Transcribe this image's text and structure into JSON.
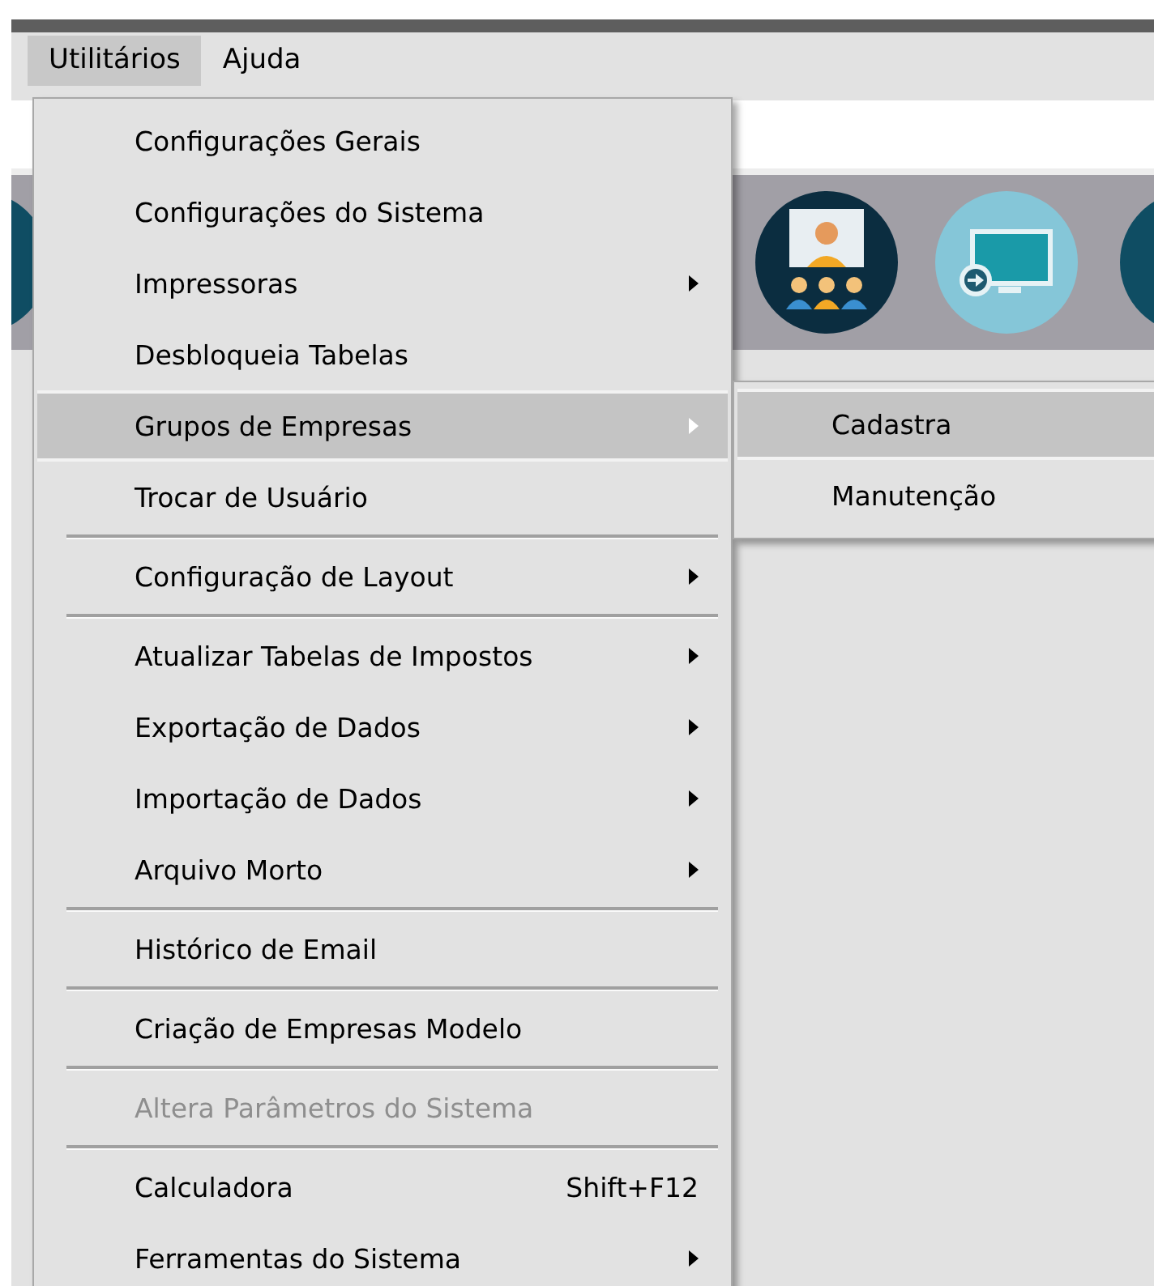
{
  "menubar": {
    "items": [
      {
        "label": "Utilitários",
        "selected": true
      },
      {
        "label": "Ajuda",
        "selected": false
      }
    ]
  },
  "menu": {
    "items": [
      {
        "kind": "item",
        "label": "Configurações Gerais",
        "submenu": false,
        "disabled": false,
        "selected": false
      },
      {
        "kind": "item",
        "label": "Configurações do Sistema",
        "submenu": false,
        "disabled": false,
        "selected": false
      },
      {
        "kind": "item",
        "label": "Impressoras",
        "submenu": true,
        "disabled": false,
        "selected": false
      },
      {
        "kind": "item",
        "label": "Desbloqueia Tabelas",
        "submenu": false,
        "disabled": false,
        "selected": false
      },
      {
        "kind": "item",
        "label": "Grupos de Empresas",
        "submenu": true,
        "disabled": false,
        "selected": true
      },
      {
        "kind": "item",
        "label": "Trocar de Usuário",
        "submenu": false,
        "disabled": false,
        "selected": false
      },
      {
        "kind": "separator"
      },
      {
        "kind": "item",
        "label": "Configuração de Layout",
        "submenu": true,
        "disabled": false,
        "selected": false
      },
      {
        "kind": "separator"
      },
      {
        "kind": "item",
        "label": "Atualizar Tabelas de Impostos",
        "submenu": true,
        "disabled": false,
        "selected": false
      },
      {
        "kind": "item",
        "label": "Exportação de Dados",
        "submenu": true,
        "disabled": false,
        "selected": false
      },
      {
        "kind": "item",
        "label": "Importação de Dados",
        "submenu": true,
        "disabled": false,
        "selected": false
      },
      {
        "kind": "item",
        "label": "Arquivo Morto",
        "submenu": true,
        "disabled": false,
        "selected": false
      },
      {
        "kind": "separator"
      },
      {
        "kind": "item",
        "label": "Histórico de Email",
        "submenu": false,
        "disabled": false,
        "selected": false
      },
      {
        "kind": "separator"
      },
      {
        "kind": "item",
        "label": "Criação de Empresas Modelo",
        "submenu": false,
        "disabled": false,
        "selected": false
      },
      {
        "kind": "separator"
      },
      {
        "kind": "item",
        "label": "Altera Parâmetros do Sistema",
        "submenu": false,
        "disabled": true,
        "selected": false
      },
      {
        "kind": "separator"
      },
      {
        "kind": "item",
        "label": "Calculadora",
        "shortcut": "Shift+F12",
        "submenu": false,
        "disabled": false,
        "selected": false
      },
      {
        "kind": "item",
        "label": "Ferramentas do Sistema",
        "submenu": true,
        "disabled": false,
        "selected": false
      }
    ]
  },
  "submenu": {
    "items": [
      {
        "label": "Cadastra",
        "selected": true
      },
      {
        "label": "Manutenção",
        "selected": false
      }
    ]
  }
}
